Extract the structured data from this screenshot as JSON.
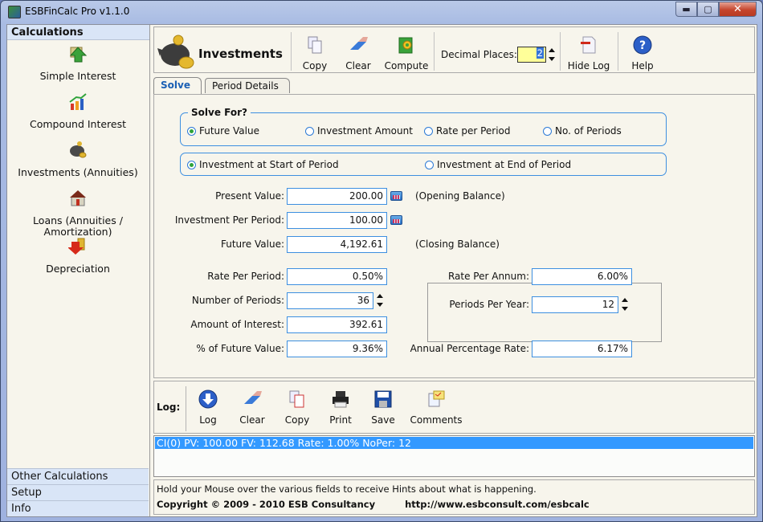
{
  "window": {
    "title": "ESBFinCalc Pro v1.1.0",
    "controls": {
      "minimize": "▬",
      "maximize": "▢",
      "close": "✕"
    }
  },
  "sidebar": {
    "header": "Calculations",
    "items": [
      {
        "label": "Simple Interest",
        "icon": "money-up-arrow-icon"
      },
      {
        "label": "Compound Interest",
        "icon": "growth-chart-icon"
      },
      {
        "label": "Investments (Annuities)",
        "icon": "piggy-bank-icon"
      },
      {
        "label": "Loans (Annuities / Amortization)",
        "icon": "house-loan-icon"
      },
      {
        "label": "Depreciation",
        "icon": "coins-down-arrow-icon"
      }
    ],
    "footer": [
      "Other Calculations",
      "Setup",
      "Info"
    ]
  },
  "header": {
    "title": "Investments",
    "toolbar": [
      {
        "label": "Copy",
        "icon": "copy-icon"
      },
      {
        "label": "Clear",
        "icon": "eraser-icon"
      },
      {
        "label": "Compute",
        "icon": "compute-gear-icon"
      }
    ],
    "decimal_places_label": "Decimal Places:",
    "decimal_places_value": "2",
    "hide_log": "Hide Log",
    "help": "Help"
  },
  "tabs": [
    {
      "label": "Solve",
      "active": true
    },
    {
      "label": "Period Details",
      "active": false
    }
  ],
  "solve": {
    "solve_for_title": "Solve For?",
    "solve_for_options": [
      {
        "label": "Future Value",
        "selected": true
      },
      {
        "label": "Investment Amount",
        "selected": false
      },
      {
        "label": "Rate per Period",
        "selected": false
      },
      {
        "label": "No. of Periods",
        "selected": false
      }
    ],
    "timing_options": [
      {
        "label": "Investment at Start of Period",
        "selected": true
      },
      {
        "label": "Investment at End of Period",
        "selected": false
      }
    ],
    "fields": {
      "present_value": {
        "label": "Present Value:",
        "value": "200.00",
        "note": "(Opening Balance)"
      },
      "investment_per_period": {
        "label": "Investment Per Period:",
        "value": "100.00"
      },
      "future_value": {
        "label": "Future Value:",
        "value": "4,192.61",
        "note": "(Closing Balance)"
      },
      "rate_per_period": {
        "label": "Rate Per Period:",
        "value": "0.50%"
      },
      "number_of_periods": {
        "label": "Number of Periods:",
        "value": "36"
      },
      "amount_of_interest": {
        "label": "Amount of Interest:",
        "value": "392.61"
      },
      "pct_of_future_value": {
        "label": "% of Future Value:",
        "value": "9.36%"
      },
      "rate_per_annum": {
        "label": "Rate Per Annum:",
        "value": "6.00%"
      },
      "periods_per_year": {
        "label": "Periods Per Year:",
        "value": "12"
      },
      "annual_percentage_rate": {
        "label": "Annual Percentage Rate:",
        "value": "6.17%"
      }
    }
  },
  "log": {
    "label": "Log:",
    "buttons": [
      {
        "label": "Log",
        "icon": "log-download-icon"
      },
      {
        "label": "Clear",
        "icon": "eraser-icon"
      },
      {
        "label": "Copy",
        "icon": "copy-icon"
      },
      {
        "label": "Print",
        "icon": "printer-icon"
      },
      {
        "label": "Save",
        "icon": "floppy-disk-icon"
      },
      {
        "label": "Comments",
        "icon": "comments-note-icon"
      }
    ],
    "entries": [
      "CI(0) PV: 100.00 FV: 112.68 Rate: 1.00% NoPer: 12"
    ]
  },
  "status": {
    "hint": "Hold your Mouse over the various fields to receive Hints about what is happening.",
    "copyright": "Copyright © 2009 - 2010 ESB Consultancy",
    "url": "http://www.esbconsult.com/esbcalc"
  },
  "colors": {
    "accent_blue": "#3d8fe0",
    "selection": "#3399ff",
    "decimal_highlight": "#ffff99",
    "sidebar_header": "#d9e5f7"
  }
}
